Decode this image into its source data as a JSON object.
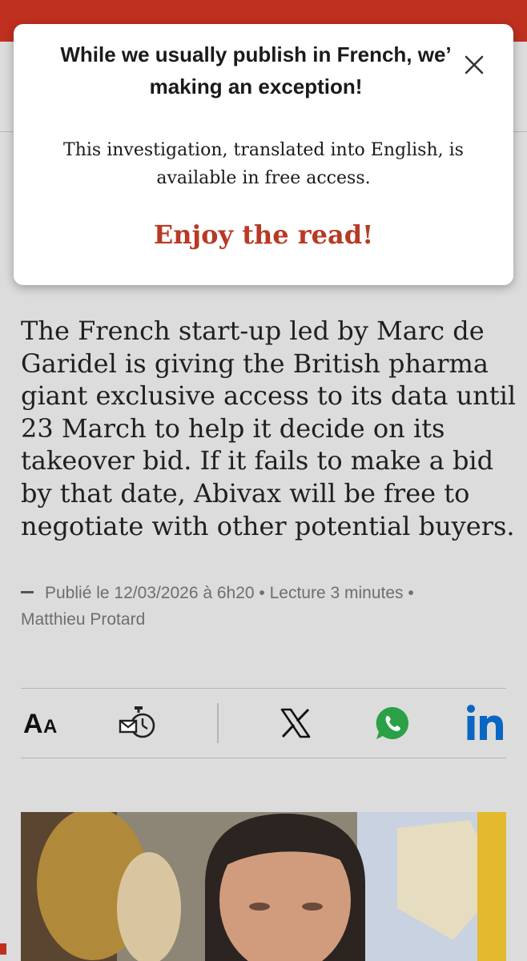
{
  "popup": {
    "title_line1": "While we usually publish in French, we’",
    "title_line2": "making an exception!",
    "body_line1": "This investigation, translated into English, is",
    "body_line2": "available in free access.",
    "cta": "Enjoy the read!",
    "close_icon": "close-icon"
  },
  "article": {
    "lead_lines": [
      "The French start-up led by Marc de",
      "Garidel is giving the British pharma",
      "giant exclusive access to its data until",
      "23 March to help it decide on its",
      "takeover bid. If it fails to make a bid",
      "by that date, Abivax will be free to",
      "negotiate with other potential buyers."
    ],
    "meta": {
      "published": "Publié le 12/03/2026 à 6h20",
      "separator": "•",
      "reading_time": "Lecture 3 minutes",
      "author": "Matthieu Protard"
    }
  },
  "share": {
    "font_size_label": "AA",
    "items": [
      "font-size-icon",
      "newsletter-reminder-icon",
      "x-icon",
      "whatsapp-icon",
      "linkedin-icon"
    ]
  },
  "colors": {
    "brand_red": "#c0301f",
    "cta_red": "#b73a24",
    "whatsapp": "#2aa146",
    "linkedin": "#0a66c2",
    "background": "#dcdcdc"
  }
}
